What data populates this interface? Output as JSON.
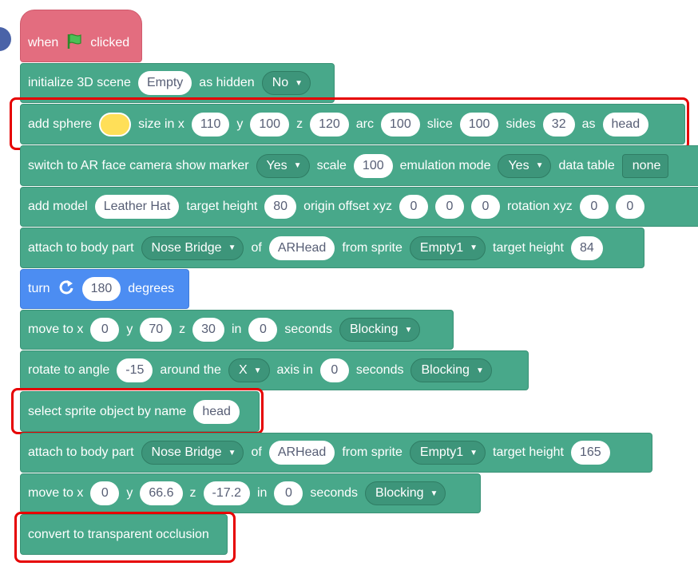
{
  "hat": {
    "when": "when",
    "clicked": "clicked",
    "icon": "green-flag-icon"
  },
  "b1": {
    "text1": "initialize 3D scene",
    "scene": "Empty",
    "text2": "as hidden",
    "hidden": "No"
  },
  "b2": {
    "text1": "add sphere",
    "color": "#ffdf58",
    "t_sx": "size in x",
    "sx": "110",
    "t_y": "y",
    "sy": "100",
    "t_z": "z",
    "sz": "120",
    "t_arc": "arc",
    "arc": "100",
    "t_slice": "slice",
    "slice": "100",
    "t_sides": "sides",
    "sides": "32",
    "t_as": "as",
    "name": "head"
  },
  "b3": {
    "text1": "switch to AR face camera show marker",
    "marker": "Yes",
    "t_scale": "scale",
    "scale": "100",
    "t_em": "emulation mode",
    "em": "Yes",
    "t_dt": "data table",
    "dt": "none"
  },
  "b4": {
    "text1": "add model",
    "model": "Leather Hat",
    "t_th": "target height",
    "th": "80",
    "t_oo": "origin offset xyz",
    "ox": "0",
    "oy": "0",
    "oz": "0",
    "t_rot": "rotation xyz",
    "rx": "0",
    "ry": "0"
  },
  "b5": {
    "text1": "attach to body part",
    "part": "Nose Bridge",
    "t_of": "of",
    "of": "ARHead",
    "t_fs": "from sprite",
    "sprite": "Empty1",
    "t_th": "target height",
    "th": "84"
  },
  "b6": {
    "text1": "turn",
    "deg": "180",
    "text2": "degrees",
    "icon": "rotate-clockwise-icon"
  },
  "b7": {
    "text1": "move to x",
    "x": "0",
    "t_y": "y",
    "y": "70",
    "t_z": "z",
    "z": "30",
    "t_in": "in",
    "sec": "0",
    "t_sec": "seconds",
    "mode": "Blocking"
  },
  "b8": {
    "text1": "rotate to angle",
    "angle": "-15",
    "t_ar": "around the",
    "axis": "X",
    "t_ai": "axis in",
    "sec": "0",
    "t_sec": "seconds",
    "mode": "Blocking"
  },
  "b9": {
    "text1": "select sprite object by name",
    "name": "head"
  },
  "b10": {
    "text1": "attach to body part",
    "part": "Nose Bridge",
    "t_of": "of",
    "of": "ARHead",
    "t_fs": "from sprite",
    "sprite": "Empty1",
    "t_th": "target height",
    "th": "165"
  },
  "b11": {
    "text1": "move to x",
    "x": "0",
    "t_y": "y",
    "y": "66.6",
    "t_z": "z",
    "z": "-17.2",
    "t_in": "in",
    "sec": "0",
    "t_sec": "seconds",
    "mode": "Blocking"
  },
  "b12": {
    "text1": "convert to transparent occlusion"
  },
  "colors": {
    "looks": "#48a88a",
    "events": "#e36d7f",
    "motion": "#4c8df2",
    "highlight": "#e60000"
  }
}
